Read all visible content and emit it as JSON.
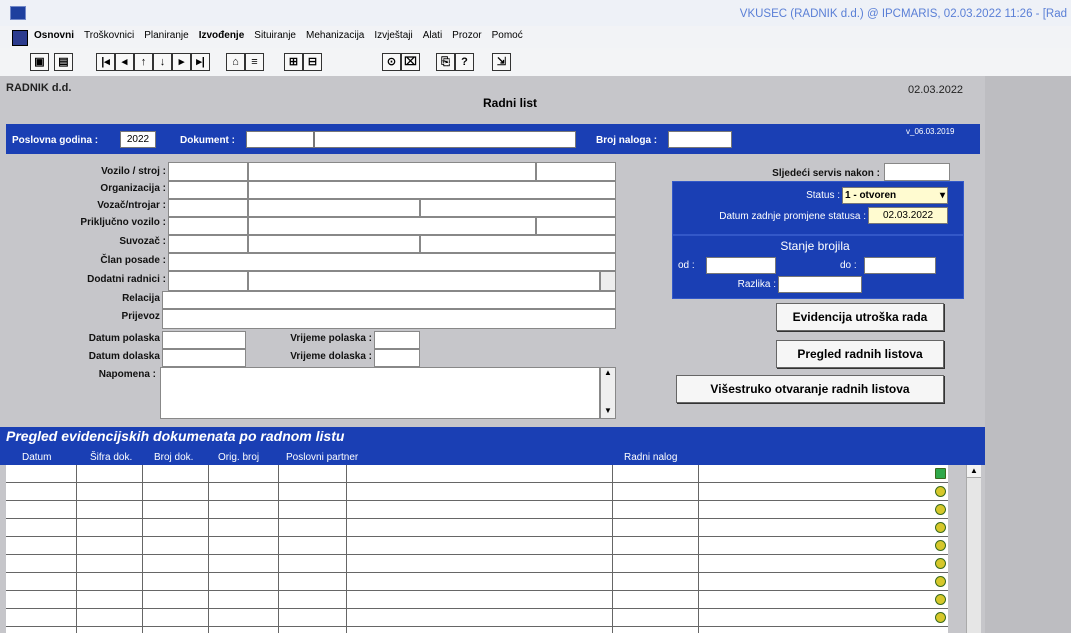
{
  "window": {
    "title": "VKUSEC (RADNIK d.d.) @ IPCMARIS, 02.03.2022 11:26 - [Rad"
  },
  "menu": [
    "Osnovni",
    "Troškovnici",
    "Planiranje",
    "Izvođenje",
    "Situiranje",
    "Mehanizacija",
    "Izvještaji",
    "Alati",
    "Prozor",
    "Pomoć"
  ],
  "header": {
    "company": "RADNIK d.d.",
    "date": "02.03.2022",
    "page_title": "Radni list"
  },
  "topbar": {
    "year_label": "Poslovna godina :",
    "year_value": "2022",
    "document_label": "Dokument :",
    "order_label": "Broj naloga :",
    "version": "v_06.03.2019"
  },
  "fields": {
    "vozilo": "Vozilo / stroj :",
    "organizacija": "Organizacija :",
    "vozac": "Vozač/ntrojar :",
    "prikljucno": "Priključno vozilo :",
    "suvozac": "Suvozač :",
    "clan": "Član posade :",
    "dodatni": "Dodatni radnici :",
    "relacija": "Relacija :",
    "prijevoz": "Prijevoz :",
    "datum_polaska": "Datum polaska :",
    "datum_dolaska": "Datum dolaska :",
    "vrijeme_polaska": "Vrijeme polaska :",
    "vrijeme_dolaska": "Vrijeme dolaska :",
    "napomena": "Napomena :"
  },
  "servis_label": "Sljedeći servis nakon :",
  "status": {
    "label": "Status :",
    "value": "1 - otvoren",
    "date_label": "Datum zadnje promjene statusa :",
    "date_value": "02.03.2022"
  },
  "brojilo": {
    "title": "Stanje brojila",
    "od": "od :",
    "do": "do :",
    "razlika": "Razlika :"
  },
  "buttons": {
    "evidencija": "Evidencija utroška rada",
    "pregled": "Pregled radnih listova",
    "visestruko": "Višestruko otvaranje radnih listova"
  },
  "grid": {
    "title": "Pregled evidencijskih dokumenata po radnom listu",
    "columns": [
      "Datum",
      "Šifra dok.",
      "Broj dok.",
      "Orig. broj",
      "Poslovni partner",
      "Radni nalog"
    ],
    "row_count": 9
  }
}
